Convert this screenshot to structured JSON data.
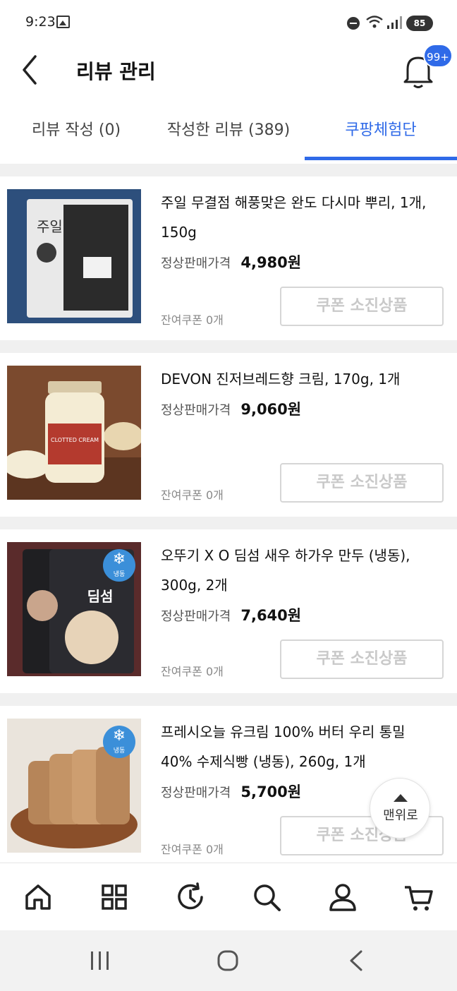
{
  "status_bar": {
    "time": "9:23",
    "battery": "85"
  },
  "header": {
    "title": "리뷰 관리",
    "notification_badge": "99+"
  },
  "tabs": [
    {
      "label": "리뷰 작성 (0)",
      "active": false
    },
    {
      "label": "작성한 리뷰 (389)",
      "active": false
    },
    {
      "label": "쿠팡체험단",
      "active": true
    }
  ],
  "price_label": "정상판매가격",
  "coupon_left_label": "잔여쿠폰 0개",
  "coupon_button_label": "쿠폰 소진상품",
  "freeze_label": "냉동",
  "products": [
    {
      "name": "주일 무결점 해풍맞은 완도 다시마 뿌리, 1개, 150g",
      "price": "4,980원",
      "thumb_text": "주일",
      "thumb_color": "#2d4f7c"
    },
    {
      "name": "DEVON 진저브레드향 크림, 170g, 1개",
      "price": "9,060원",
      "thumb_text": "CLOTTED CREAM",
      "thumb_color": "#7b4a2e"
    },
    {
      "name": "오뚜기 X O 딤섬 새우 하가우 만두 (냉동), 300g, 2개",
      "price": "7,640원",
      "thumb_text": "딤섬",
      "thumb_color": "#5a2b2b"
    },
    {
      "name": "프레시오늘 유크림 100% 버터 우리 통밀 40% 수제식빵 (냉동), 260g, 1개",
      "price": "5,700원",
      "thumb_text": "",
      "thumb_color": "#c89a6a"
    }
  ],
  "top_button": {
    "label": "맨위로"
  },
  "bottom_nav": [
    "home-icon",
    "category-icon",
    "recent-icon",
    "search-icon",
    "user-icon",
    "cart-icon"
  ],
  "accent_color": "#2f6ae8"
}
